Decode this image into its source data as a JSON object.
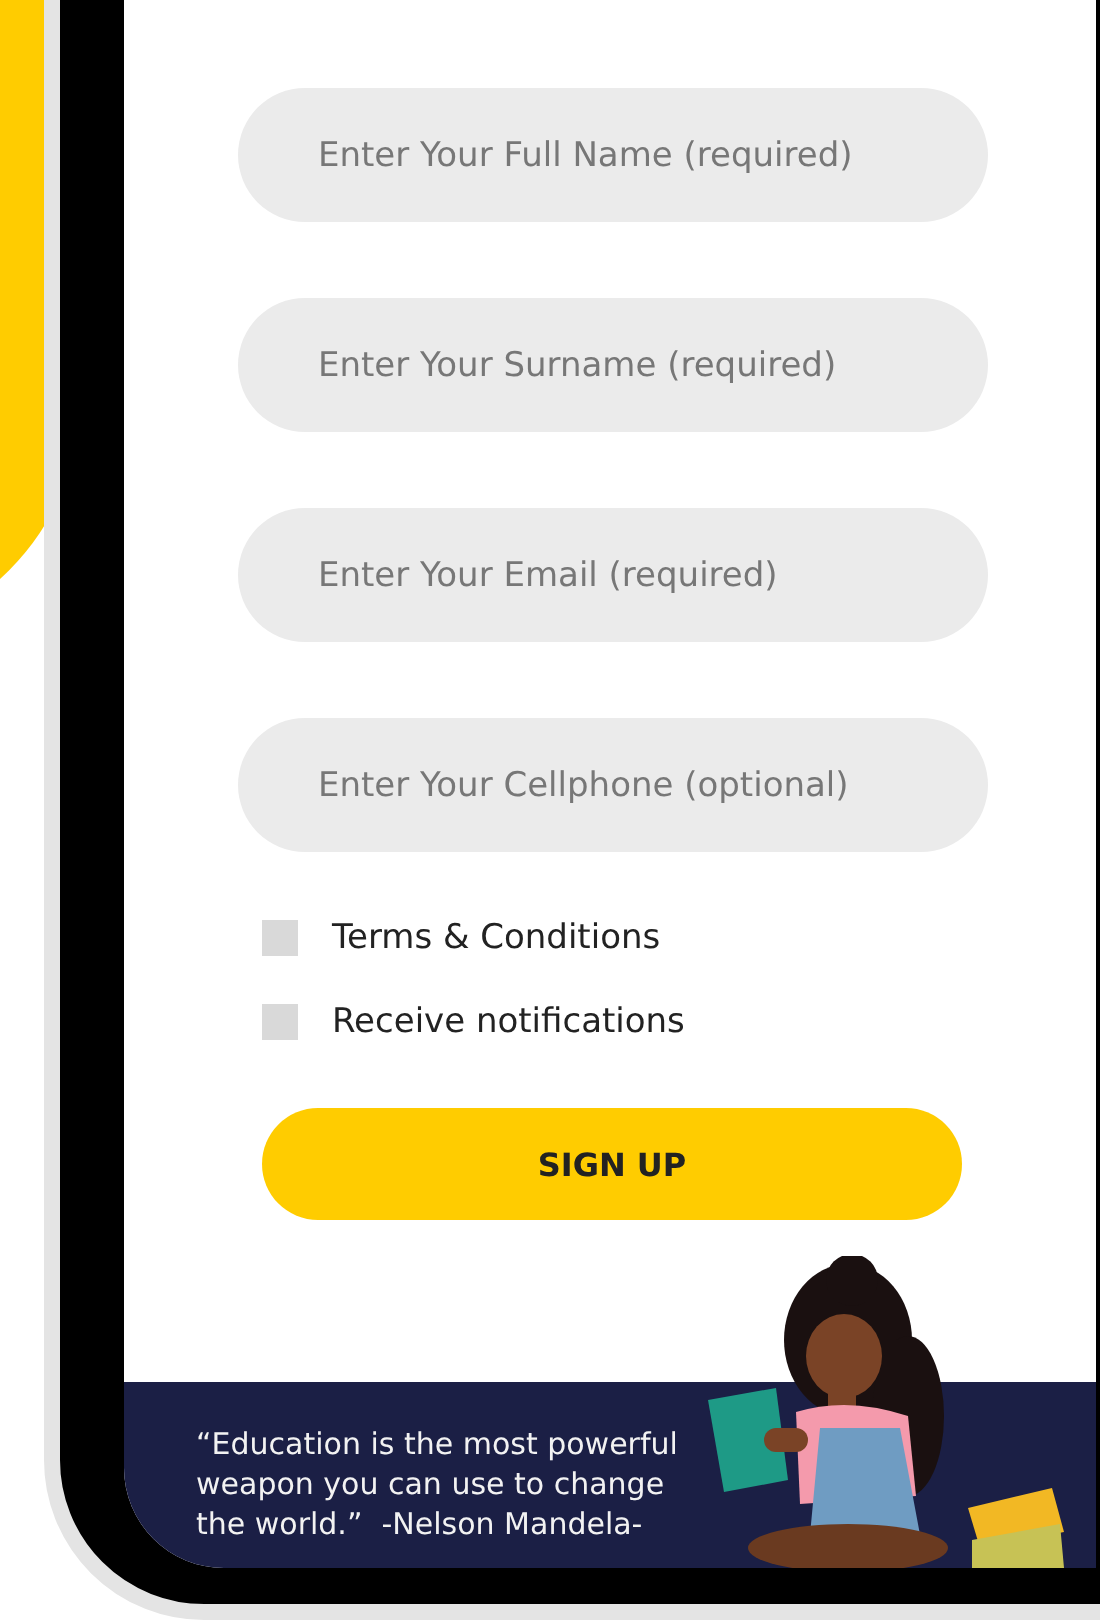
{
  "form": {
    "fields": [
      {
        "placeholder": "Enter Your Full Name (required)"
      },
      {
        "placeholder": "Enter Your Surname (required)"
      },
      {
        "placeholder": "Enter Your Email (required)"
      },
      {
        "placeholder": "Enter Your Cellphone (optional)"
      }
    ],
    "checkboxes": [
      {
        "label": "Terms & Conditions",
        "checked": false
      },
      {
        "label": "Receive notifications",
        "checked": false
      }
    ],
    "submit": {
      "label": "SIGN UP"
    }
  },
  "footer": {
    "quote": "“Education is the most powerful weapon you can use to change the world.”  -Nelson Mandela-"
  }
}
